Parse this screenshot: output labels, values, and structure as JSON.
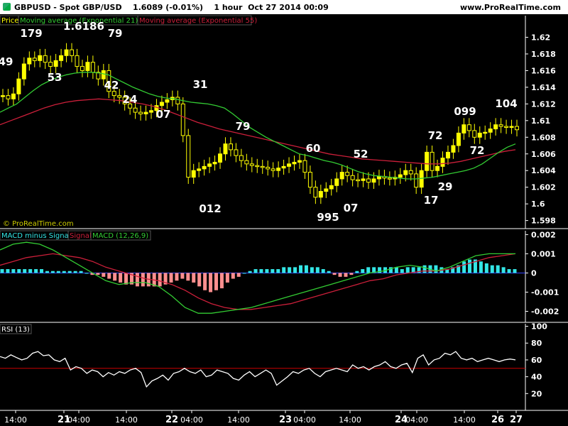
{
  "header": {
    "title": "GBPUSD - Spot GBP/USD",
    "price": "1.6089",
    "change": "(-0.01%)",
    "timeframe": "1 hour",
    "datetime": "Oct 27 2014 00:09",
    "site": "www.ProRealTime.com"
  },
  "watermark": "© ProRealTime.com",
  "colors": {
    "background": "#000000",
    "candle_up": "#ffff00",
    "ema21": "#33cc33",
    "ema55": "#cc1f3a",
    "macd_pos": "#33e6e6",
    "macd_neg": "#ff8f8f",
    "rsi": "#ffffff",
    "rsi_line": "#cc0000"
  },
  "chart_data": [
    {
      "type": "candlestick",
      "name": "price",
      "legend": [
        "Price",
        "Moving average (Exponential 21)",
        "Moving average (Exponential 55)"
      ],
      "y_ticks": [
        "1.62",
        "1.618",
        "1.616",
        "1.614",
        "1.612",
        "1.61",
        "1.608",
        "1.606",
        "1.604",
        "1.602",
        "1.6",
        "1.598"
      ],
      "ylim": [
        1.5972,
        1.6226
      ],
      "x_ticks": [
        "14:00",
        "21",
        "04:00",
        "14:00",
        "22",
        "04:00",
        "14:00",
        "23",
        "04:00",
        "14:00",
        "24",
        "04:00",
        "14:00",
        "26",
        "27"
      ],
      "annotations": [
        "49",
        "179",
        "1.6186",
        "79",
        "53",
        "42",
        "24",
        "07",
        "31",
        "79",
        "012",
        "60",
        "52",
        "995",
        "07",
        "72",
        "17",
        "29",
        "099",
        "72",
        "104"
      ],
      "close": [
        1.613,
        1.6126,
        1.6132,
        1.615,
        1.6168,
        1.6175,
        1.6172,
        1.6178,
        1.617,
        1.6165,
        1.6172,
        1.6178,
        1.6185,
        1.6178,
        1.6165,
        1.616,
        1.617,
        1.6158,
        1.615,
        1.616,
        1.6135,
        1.613,
        1.6128,
        1.612,
        1.6115,
        1.611,
        1.6108,
        1.611,
        1.6112,
        1.6118,
        1.6122,
        1.6125,
        1.6128,
        1.612,
        1.6082,
        1.6032,
        1.604,
        1.6042,
        1.6045,
        1.6048,
        1.605,
        1.606,
        1.6072,
        1.6065,
        1.6058,
        1.6052,
        1.6048,
        1.6046,
        1.6045,
        1.6044,
        1.6042,
        1.604,
        1.6043,
        1.6045,
        1.6048,
        1.605,
        1.6052,
        1.6038,
        1.602,
        1.6008,
        1.6015,
        1.6018,
        1.6022,
        1.603,
        1.6038,
        1.6034,
        1.6029,
        1.6028,
        1.603,
        1.6026,
        1.603,
        1.6033,
        1.6031,
        1.603,
        1.6032,
        1.6035,
        1.604,
        1.6036,
        1.602,
        1.604,
        1.6062,
        1.604,
        1.6045,
        1.6055,
        1.6062,
        1.607,
        1.6085,
        1.6095,
        1.6088,
        1.608,
        1.6085,
        1.6086,
        1.609,
        1.6095,
        1.6093,
        1.6092,
        1.6093,
        1.6089
      ],
      "ema21": [
        1.611,
        1.6115,
        1.612,
        1.6128,
        1.6136,
        1.6143,
        1.6148,
        1.6152,
        1.6155,
        1.6157,
        1.6158,
        1.6158,
        1.6157,
        1.6155,
        1.615,
        1.6145,
        1.614,
        1.6136,
        1.6132,
        1.6129,
        1.6127,
        1.6126,
        1.6124,
        1.6122,
        1.6121,
        1.612,
        1.6118,
        1.6115,
        1.6108,
        1.61,
        1.6092,
        1.6086,
        1.608,
        1.6075,
        1.607,
        1.6065,
        1.606,
        1.6058,
        1.6055,
        1.6052,
        1.605,
        1.6047,
        1.6043,
        1.6039,
        1.6036,
        1.6034,
        1.6033,
        1.6032,
        1.6031,
        1.603,
        1.603,
        1.6031,
        1.6032,
        1.6034,
        1.6036,
        1.6038,
        1.604,
        1.6043,
        1.6048,
        1.6055,
        1.6062,
        1.6068,
        1.6072
      ],
      "ema55": [
        1.6095,
        1.61,
        1.6105,
        1.611,
        1.6115,
        1.6119,
        1.6122,
        1.6124,
        1.6125,
        1.6126,
        1.6125,
        1.6124,
        1.6122,
        1.612,
        1.6117,
        1.6113,
        1.6108,
        1.6103,
        1.6098,
        1.6094,
        1.609,
        1.6087,
        1.6084,
        1.6081,
        1.6078,
        1.6075,
        1.6072,
        1.6069,
        1.6066,
        1.6063,
        1.606,
        1.6058,
        1.6056,
        1.6054,
        1.6053,
        1.6052,
        1.6051,
        1.605,
        1.6049,
        1.6048,
        1.6048,
        1.6049,
        1.6051,
        1.6054,
        1.6057,
        1.606,
        1.6063,
        1.6065
      ]
    },
    {
      "type": "bar+line",
      "name": "macd",
      "legend": [
        "MACD minus Signal",
        "Signal",
        "MACD (12,26,9)"
      ],
      "y_ticks": [
        "0.002",
        "0.001",
        "0",
        "-0.001",
        "-0.002"
      ],
      "ylim": [
        -0.0025,
        0.0022
      ],
      "hist": [
        0.0002,
        0.0002,
        0.0002,
        0.0002,
        0.0002,
        0.0002,
        0.0002,
        0.0002,
        0.0001,
        0.0001,
        0.0001,
        0.0001,
        0.0001,
        0.0001,
        0.0001,
        0.0,
        -0.0001,
        -0.0001,
        -0.0002,
        -0.0003,
        -0.0004,
        -0.0005,
        -0.0006,
        -0.0006,
        -0.0007,
        -0.0007,
        -0.0007,
        -0.0007,
        -0.0007,
        -0.0006,
        -0.0005,
        -0.0004,
        -0.0003,
        -0.0004,
        -0.0005,
        -0.0007,
        -0.0009,
        -0.001,
        -0.0009,
        -0.0008,
        -0.0005,
        -0.0003,
        -0.0002,
        0.0,
        0.0001,
        0.0002,
        0.0002,
        0.0002,
        0.0002,
        0.0002,
        0.0003,
        0.0003,
        0.0003,
        0.0004,
        0.0004,
        0.0003,
        0.0003,
        0.0002,
        0.0001,
        -0.0001,
        -0.0002,
        -0.0002,
        -0.0001,
        0.0001,
        0.0002,
        0.0003,
        0.0003,
        0.0003,
        0.0003,
        0.0003,
        0.0003,
        0.0002,
        0.0003,
        0.0003,
        0.0003,
        0.0004,
        0.0004,
        0.0004,
        0.0003,
        0.0002,
        0.0003,
        0.0004,
        0.0006,
        0.0007,
        0.0007,
        0.0006,
        0.0005,
        0.0004,
        0.0004,
        0.0003,
        0.0002,
        0.0002
      ],
      "macd": [
        0.0012,
        0.0015,
        0.0016,
        0.0015,
        0.0012,
        0.0008,
        0.0004,
        0.0,
        -0.0004,
        -0.0006,
        -0.0005,
        -0.0005,
        -0.0007,
        -0.0012,
        -0.0018,
        -0.0021,
        -0.0021,
        -0.002,
        -0.0019,
        -0.0018,
        -0.0016,
        -0.0014,
        -0.0012,
        -0.001,
        -0.0008,
        -0.0006,
        -0.0004,
        -0.0002,
        0.0,
        0.0001,
        0.0003,
        0.0004,
        0.0003,
        0.0001,
        0.0003,
        0.0006,
        0.0009,
        0.001,
        0.001,
        0.001
      ],
      "signal": [
        0.0004,
        0.0006,
        0.0008,
        0.0009,
        0.001,
        0.0009,
        0.0008,
        0.0006,
        0.0003,
        0.0001,
        -0.0001,
        -0.0003,
        -0.0004,
        -0.0006,
        -0.0009,
        -0.0013,
        -0.0016,
        -0.0018,
        -0.0019,
        -0.0019,
        -0.0018,
        -0.0017,
        -0.0016,
        -0.0014,
        -0.0012,
        -0.001,
        -0.0008,
        -0.0006,
        -0.0004,
        -0.0003,
        -0.0001,
        0.0,
        0.0001,
        0.0001,
        0.0002,
        0.0004,
        0.0006,
        0.0008,
        0.0009,
        0.001
      ]
    },
    {
      "type": "line",
      "name": "rsi",
      "legend": [
        "RSI (13)"
      ],
      "y_ticks": [
        "100",
        "80",
        "60",
        "40",
        "20"
      ],
      "ylim": [
        0,
        103
      ],
      "reference_line": 50,
      "values": [
        64,
        62,
        66,
        63,
        60,
        62,
        68,
        70,
        65,
        66,
        60,
        58,
        62,
        48,
        52,
        50,
        44,
        48,
        46,
        40,
        45,
        42,
        46,
        44,
        48,
        50,
        45,
        28,
        35,
        38,
        42,
        36,
        44,
        46,
        50,
        46,
        44,
        48,
        40,
        42,
        48,
        46,
        44,
        38,
        36,
        42,
        46,
        40,
        44,
        48,
        44,
        30,
        35,
        40,
        46,
        44,
        48,
        50,
        44,
        40,
        46,
        48,
        50,
        48,
        46,
        54,
        50,
        52,
        48,
        52,
        54,
        58,
        52,
        50,
        54,
        56,
        45,
        62,
        66,
        54,
        60,
        62,
        68,
        66,
        70,
        62,
        60,
        62,
        58,
        60,
        62,
        60,
        58,
        60,
        61,
        60
      ]
    }
  ]
}
